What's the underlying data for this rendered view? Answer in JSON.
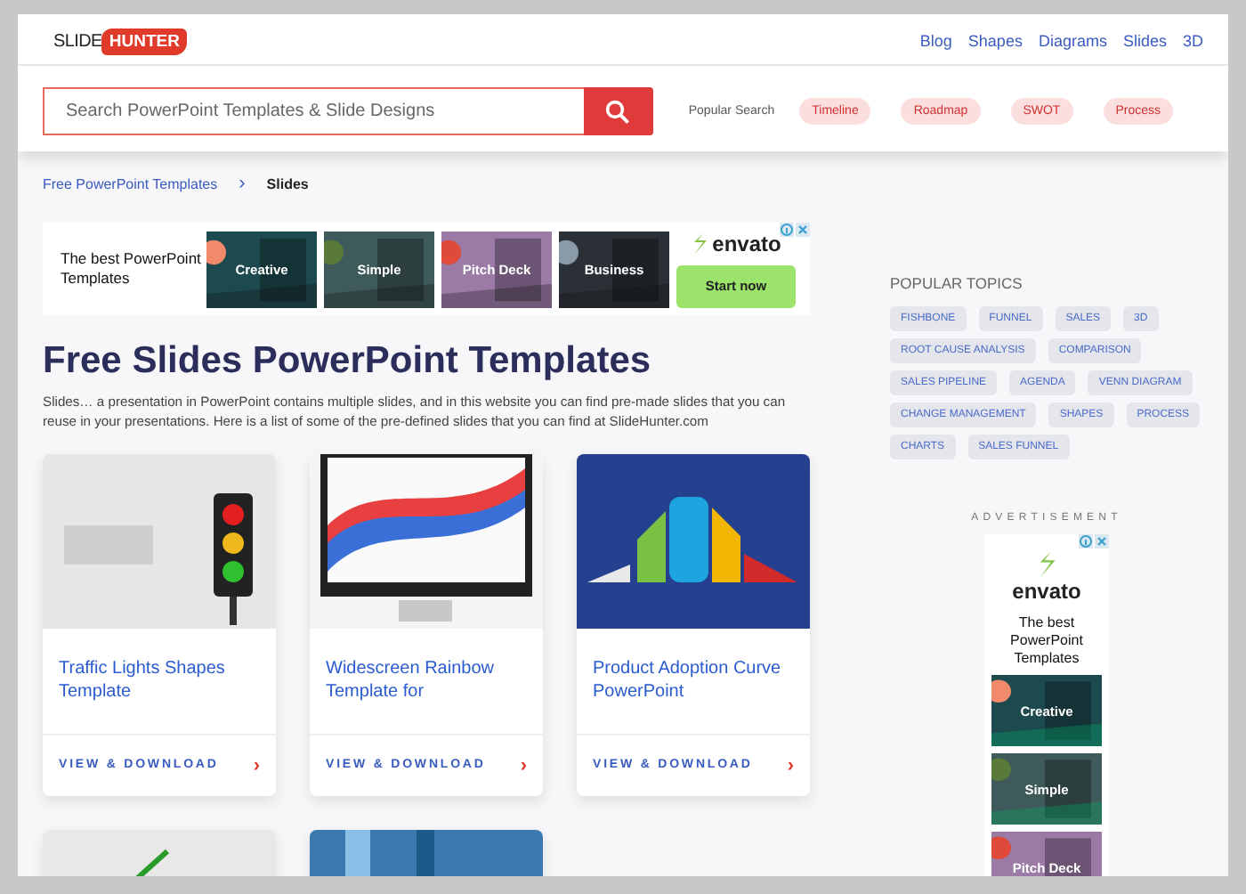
{
  "logo": {
    "left": "SLIDE",
    "right": "HUNTER"
  },
  "nav": [
    "Blog",
    "Shapes",
    "Diagrams",
    "Slides",
    "3D"
  ],
  "search": {
    "placeholder": "Search PowerPoint Templates & Slide Designs"
  },
  "popular_search": {
    "label": "Popular Search",
    "chips": [
      "Timeline",
      "Roadmap",
      "SWOT",
      "Process"
    ]
  },
  "breadcrumb": {
    "link": "Free PowerPoint Templates",
    "separator": "›",
    "current": "Slides"
  },
  "top_ad": {
    "headline": "The best PowerPoint Templates",
    "tiles": [
      "Creative",
      "Simple",
      "Pitch Deck",
      "Business"
    ],
    "brand": "envato",
    "cta": "Start now"
  },
  "title": "Free Slides PowerPoint Templates",
  "intro": "Slides… a presentation in PowerPoint contains multiple slides, and in this website you can find pre-made slides that you can reuse in your presentations. Here is a list of some of the pre-defined slides that you can find at SlideHunter.com",
  "cards": [
    {
      "title": "Traffic Lights Shapes Template",
      "link": "VIEW & DOWNLOAD",
      "arrow": "›"
    },
    {
      "title": "Widescreen Rainbow Template for",
      "link": "VIEW & DOWNLOAD",
      "arrow": "›"
    },
    {
      "title": "Product Adoption Curve PowerPoint",
      "link": "VIEW & DOWNLOAD",
      "arrow": "›"
    }
  ],
  "popular_topics": {
    "title": "POPULAR TOPICS",
    "tags": [
      "FISHBONE",
      "FUNNEL",
      "SALES",
      "3D",
      "ROOT CAUSE ANALYSIS",
      "COMPARISON",
      "SALES PIPELINE",
      "AGENDA",
      "VENN DIAGRAM",
      "CHANGE MANAGEMENT",
      "SHAPES",
      "PROCESS",
      "CHARTS",
      "SALES FUNNEL"
    ]
  },
  "side_ad": {
    "label": "ADVERTISEMENT",
    "brand": "envato",
    "headline": "The best PowerPoint Templates",
    "tiles": [
      "Creative",
      "Simple",
      "Pitch Deck"
    ]
  }
}
